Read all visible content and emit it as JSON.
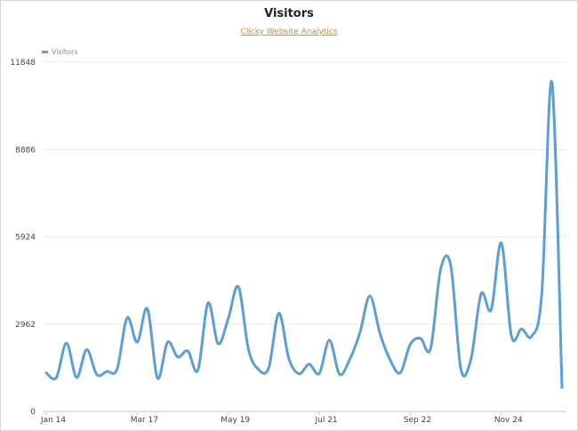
{
  "chart_data": {
    "type": "line",
    "title": "Visitors",
    "subtitle": "Clicky Website Analytics",
    "legend": {
      "position": "top-left",
      "entries": [
        "Visitors"
      ]
    },
    "series_color": "#5b9fd3",
    "grid": true,
    "ylim": [
      0,
      11848
    ],
    "yticks": [
      0,
      2962,
      5924,
      8886,
      11848
    ],
    "xticks": [
      {
        "label": "Jan 14",
        "index": 0
      },
      {
        "label": "Mar 17",
        "index": 9
      },
      {
        "label": "May 19",
        "index": 18
      },
      {
        "label": "Jul 21",
        "index": 27
      },
      {
        "label": "Sep 22",
        "index": 36
      },
      {
        "label": "Nov 24",
        "index": 45
      }
    ],
    "series": [
      {
        "name": "Visitors",
        "values": [
          1310,
          1150,
          2320,
          1150,
          2100,
          1250,
          1360,
          1430,
          3180,
          2350,
          3480,
          1130,
          2350,
          1850,
          2050,
          1400,
          3680,
          2300,
          3150,
          4230,
          2100,
          1420,
          1480,
          3330,
          1780,
          1280,
          1600,
          1290,
          2420,
          1260,
          1760,
          2650,
          3920,
          2650,
          1750,
          1310,
          2280,
          2480,
          2130,
          4820,
          4950,
          1440,
          1780,
          3990,
          3450,
          5720,
          2560,
          2800,
          2550,
          4000,
          11170,
          820
        ]
      }
    ]
  }
}
